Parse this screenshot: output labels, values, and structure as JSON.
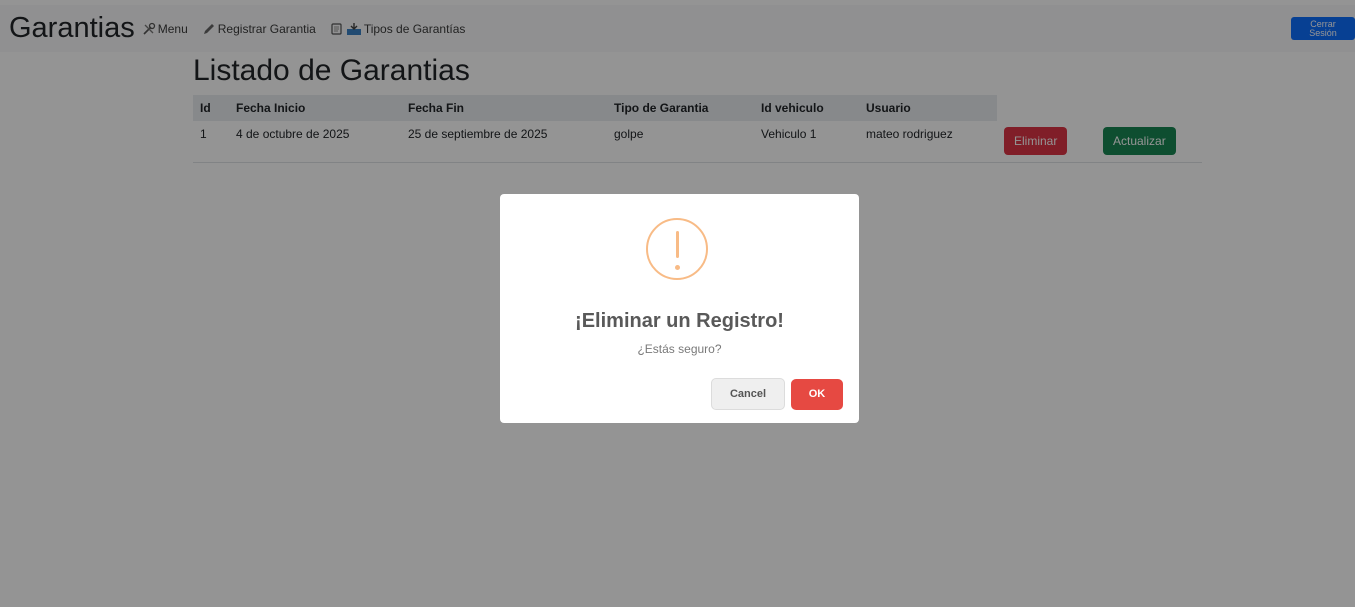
{
  "nav": {
    "brand": "Garantias",
    "menu_label": "Menu",
    "register_label": "Registrar Garantia",
    "types_label": "Tipos de Garantías",
    "logout_label": "Cerrar Sesión"
  },
  "page": {
    "title": "Listado de Garantias"
  },
  "table": {
    "headers": [
      "Id",
      "Fecha Inicio",
      "Fecha Fin",
      "Tipo de Garantia",
      "Id vehiculo",
      "Usuario"
    ],
    "rows": [
      {
        "id": "1",
        "fecha_inicio": "4 de octubre de 2025",
        "fecha_fin": "25 de septiembre de 2025",
        "tipo": "golpe",
        "vehiculo": "Vehiculo 1",
        "usuario": "mateo rodriguez",
        "delete_label": "Eliminar",
        "update_label": "Actualizar"
      }
    ]
  },
  "dialog": {
    "icon": "warning-icon",
    "title": "¡Eliminar un Registro!",
    "text": "¿Estás seguro?",
    "cancel_label": "Cancel",
    "ok_label": "OK"
  },
  "colors": {
    "primary": "#0d6efd",
    "danger": "#dc3545",
    "success": "#198754",
    "warning_icon": "#f8bb86",
    "confirm": "#e64942"
  }
}
